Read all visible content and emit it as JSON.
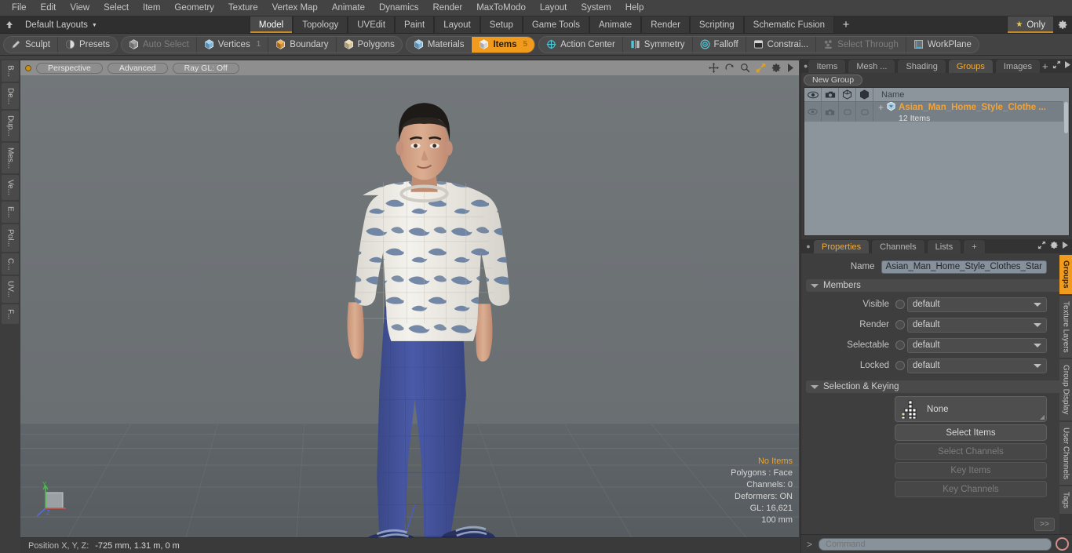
{
  "menubar": {
    "items": [
      "File",
      "Edit",
      "View",
      "Select",
      "Item",
      "Geometry",
      "Texture",
      "Vertex Map",
      "Animate",
      "Dynamics",
      "Render",
      "MaxToModo",
      "Layout",
      "System",
      "Help"
    ]
  },
  "layoutbar": {
    "home_icon": "home-icon",
    "layout_label": "Default Layouts",
    "tabs": [
      {
        "label": "Model",
        "active": true
      },
      {
        "label": "Topology",
        "active": false
      },
      {
        "label": "UVEdit",
        "active": false
      },
      {
        "label": "Paint",
        "active": false
      },
      {
        "label": "Layout",
        "active": false
      },
      {
        "label": "Setup",
        "active": false
      },
      {
        "label": "Game Tools",
        "active": false
      },
      {
        "label": "Animate",
        "active": false
      },
      {
        "label": "Render",
        "active": false
      },
      {
        "label": "Scripting",
        "active": false
      },
      {
        "label": "Schematic Fusion",
        "active": false
      }
    ],
    "add_tab": "+",
    "only_label": "Only",
    "star_icon": "star-icon",
    "gear_icon": "gear-icon"
  },
  "toolbar": {
    "group1": [
      {
        "label": "Sculpt",
        "icon": "pencil-icon",
        "state": "normal"
      },
      {
        "label": "Presets",
        "icon": "sphere-icon",
        "state": "normal"
      }
    ],
    "group2": [
      {
        "label": "Auto Select",
        "icon": "cube-grey-icon",
        "state": "disabled",
        "num": ""
      },
      {
        "label": "Vertices",
        "icon": "cube-blue-icon",
        "state": "normal",
        "num": "1"
      },
      {
        "label": "Boundary",
        "icon": "cube-orange-icon",
        "state": "normal",
        "num": ""
      },
      {
        "label": "Polygons",
        "icon": "cube-tan-icon",
        "state": "normal",
        "num": ""
      }
    ],
    "group3": [
      {
        "label": "Materials",
        "icon": "cube-blue-icon",
        "state": "normal",
        "num": ""
      },
      {
        "label": "Items",
        "icon": "cube-white-icon",
        "state": "active",
        "num": "5"
      }
    ],
    "group4": [
      {
        "label": "Action Center",
        "icon": "crosshair-icon",
        "state": "normal"
      },
      {
        "label": "Symmetry",
        "icon": "mirror-icon",
        "state": "normal"
      },
      {
        "label": "Falloff",
        "icon": "target-icon",
        "state": "normal"
      },
      {
        "label": "Constrai...",
        "icon": "constraint-icon",
        "state": "normal"
      },
      {
        "label": "Select Through",
        "icon": "selectthrough-icon",
        "state": "disabled"
      },
      {
        "label": "WorkPlane",
        "icon": "workplane-icon",
        "state": "normal"
      }
    ]
  },
  "left_rail": {
    "tabs": [
      "B...",
      "De...",
      "Dup...",
      "Mes...",
      "Ve...",
      "E...",
      "Pol...",
      "C...",
      "UV...",
      "F..."
    ]
  },
  "viewport": {
    "header": {
      "dot": "viewport-dot",
      "pills": [
        "Perspective",
        "Advanced",
        "Ray GL: Off"
      ],
      "icons": [
        "move-icon",
        "rotate-icon",
        "zoom-icon",
        "fit-icon",
        "gear-icon",
        "play-icon"
      ]
    },
    "stats": {
      "items_status": "No Items",
      "polygons": "Polygons : Face",
      "channels": "Channels: 0",
      "deformers": "Deformers: ON",
      "gl": "GL: 16,621",
      "scale": "100 mm"
    },
    "axis_gizmo": {
      "y": "Y",
      "z": "Z"
    },
    "statusbar": {
      "label": "Position X, Y, Z:",
      "value": "-725 mm, 1.31 m, 0 m"
    },
    "scene": {
      "description": "3D character model, Asian man in home style clothes, standing",
      "sweater_color": "#f2f0ea",
      "sweater_pattern": "blue whale print",
      "pants_color": "#41509a",
      "slippers_color": "#2b3566",
      "hair_color": "#1d1a18",
      "skin_color": "#d9a78a",
      "bg_top": "#6f7477",
      "bg_floor": "#5d6366",
      "grid_color": "#787d80",
      "x_axis_color": "#d35a4a",
      "z_axis_color": "#4a5ad3"
    }
  },
  "right_panel": {
    "top_tabs": [
      {
        "label": "Items",
        "active": false
      },
      {
        "label": "Mesh ...",
        "active": false
      },
      {
        "label": "Shading",
        "active": false
      },
      {
        "label": "Groups",
        "active": true
      },
      {
        "label": "Images",
        "active": false
      }
    ],
    "top_tab_tools": [
      "+",
      "expand-icon",
      "play-icon"
    ],
    "new_group_button": "New Group",
    "group_list": {
      "col_icons": [
        "eye-icon",
        "render-icon",
        "wireframe-icon",
        "shade-icon"
      ],
      "name_header": "Name",
      "rows": [
        {
          "expand": "+",
          "icon": "group-icon",
          "name": "Asian_Man_Home_Style_Clothe ...",
          "subtitle": "12 Items"
        }
      ]
    },
    "props_tabs": [
      {
        "label": "Properties",
        "active": true
      },
      {
        "label": "Channels",
        "active": false
      },
      {
        "label": "Lists",
        "active": false
      },
      {
        "label": "+",
        "active": false
      }
    ],
    "props_tab_tools": [
      "expand-icon",
      "gear-icon",
      "play-icon"
    ],
    "name_row": {
      "label": "Name",
      "value": "Asian_Man_Home_Style_Clothes_Star"
    },
    "members_section": "Members",
    "member_rows": [
      {
        "label": "Visible",
        "value": "default"
      },
      {
        "label": "Render",
        "value": "default"
      },
      {
        "label": "Selectable",
        "value": "default"
      },
      {
        "label": "Locked",
        "value": "default"
      }
    ],
    "selection_section": "Selection & Keying",
    "selection_mode": {
      "icon": "dotgrid-icon",
      "value": "None"
    },
    "selection_buttons": [
      {
        "label": "Select Items",
        "disabled": false
      },
      {
        "label": "Select Channels",
        "disabled": true
      },
      {
        "label": "Key Items",
        "disabled": true
      },
      {
        "label": "Key Channels",
        "disabled": true
      }
    ],
    "more_button": ">>",
    "right_rail": [
      {
        "label": "Groups",
        "active": true
      },
      {
        "label": "Texture Layers",
        "active": false
      },
      {
        "label": "Group Display",
        "active": false
      },
      {
        "label": "User Channels",
        "active": false
      },
      {
        "label": "Tags",
        "active": false
      }
    ]
  },
  "command_bar": {
    "prompt": ">",
    "placeholder": "Command",
    "record_icon": "record-icon"
  }
}
